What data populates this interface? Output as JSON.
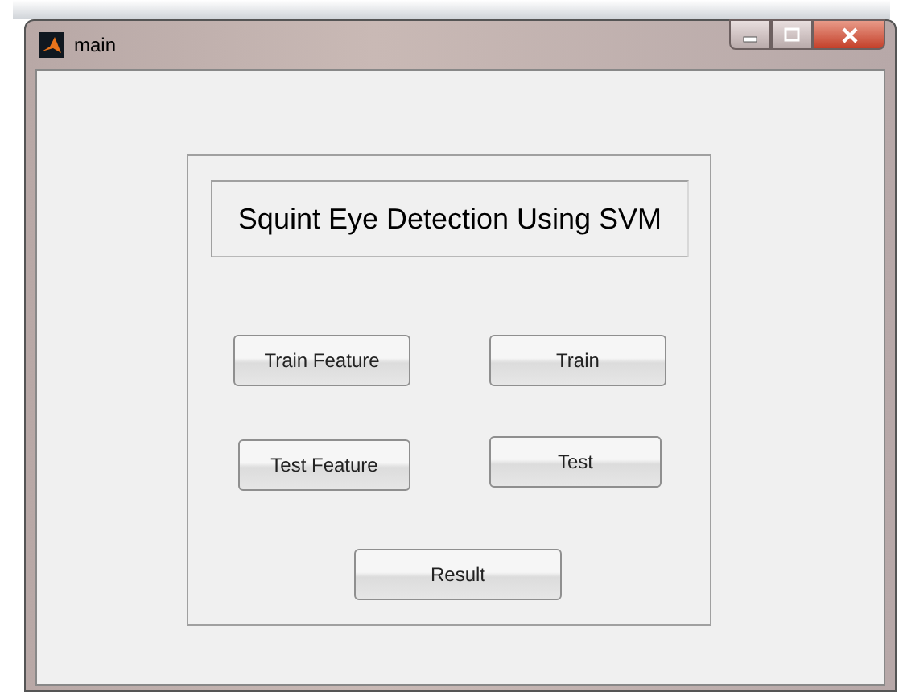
{
  "window": {
    "title": "main"
  },
  "panel": {
    "heading": "Squint Eye Detection Using SVM"
  },
  "buttons": [
    {
      "label": "Train Feature"
    },
    {
      "label": "Train"
    },
    {
      "label": "Test Feature"
    },
    {
      "label": "Test"
    },
    {
      "label": "Result"
    }
  ]
}
